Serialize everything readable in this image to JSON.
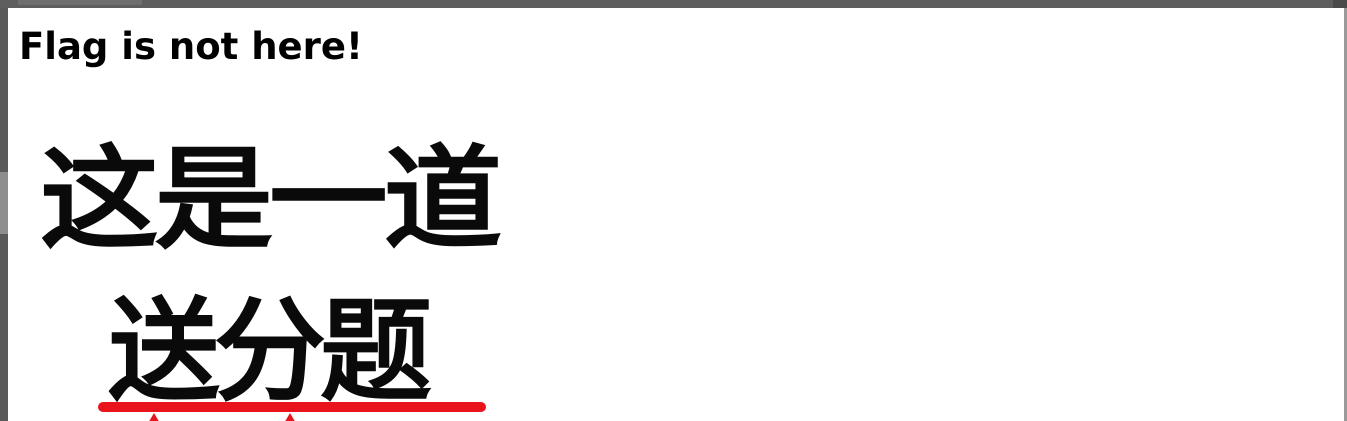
{
  "page": {
    "heading": "Flag is not here!"
  },
  "image": {
    "line1": "这是一道",
    "line2": "送分题",
    "accent_color": "#e8131b"
  }
}
